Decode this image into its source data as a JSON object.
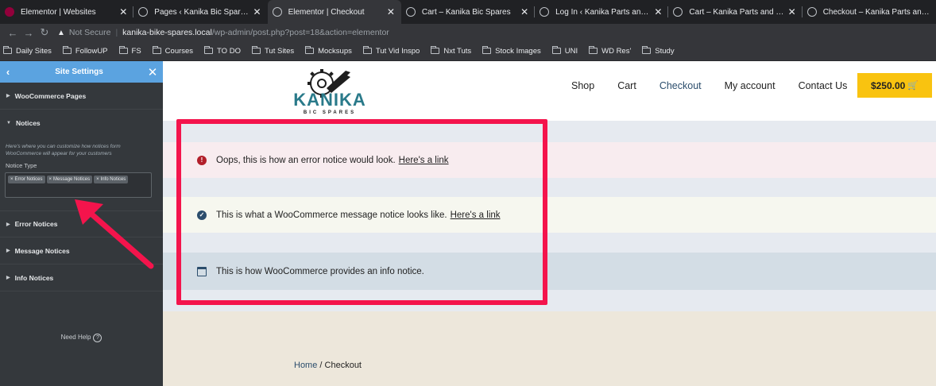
{
  "browser": {
    "tabs": [
      {
        "title": "Elementor | Websites",
        "icon": "elementor-favicon",
        "active": false
      },
      {
        "title": "Pages ‹ Kanika Bic Spares — WordPress",
        "icon": "wordpress-favicon",
        "active": false
      },
      {
        "title": "Elementor | Checkout",
        "icon": "wordpress-favicon",
        "active": true
      },
      {
        "title": "Cart – Kanika Bic Spares",
        "icon": "wordpress-favicon",
        "active": false
      },
      {
        "title": "Log In ‹ Kanika Parts and Spares",
        "icon": "wordpress-favicon",
        "active": false
      },
      {
        "title": "Cart – Kanika Parts and Spares",
        "icon": "wordpress-favicon",
        "active": false
      },
      {
        "title": "Checkout – Kanika Parts and Spares",
        "icon": "wordpress-favicon",
        "active": false
      }
    ],
    "tab_close": "✕",
    "address": {
      "security": "Not Secure",
      "host": "kanika-bike-spares.local",
      "path": "/wp-admin/post.php?post=18&action=elementor"
    },
    "bookmarks": [
      "Daily Sites",
      "FollowUP",
      "FS",
      "Courses",
      "TO DO",
      "Tut Sites",
      "Mocksups",
      "Tut Vid Inspo",
      "Nxt Tuts",
      "Stock Images",
      "UNI",
      "WD Res'",
      "Study"
    ]
  },
  "panel": {
    "title": "Site Settings",
    "sections": {
      "woocommerce_pages": "WooCommerce Pages",
      "notices": "Notices",
      "error_notices": "Error Notices",
      "message_notices": "Message Notices",
      "info_notices": "Info Notices"
    },
    "notices_description": "Here's where you can customize how notices form WooCommerce will appear for your customers",
    "notice_type_label": "Notice Type",
    "notice_type_chips": [
      "Error Notices",
      "Message Notices",
      "Info Notices"
    ],
    "need_help": "Need Help",
    "accent": "#5ba3e0"
  },
  "site": {
    "logo_text": "KANIKA",
    "logo_subtext": "BIC SPARES",
    "nav": [
      "Shop",
      "Cart",
      "Checkout",
      "My account",
      "Contact Us"
    ],
    "active_nav": "Checkout",
    "cart_total": "$250.00",
    "cart_button_color": "#f9c310",
    "notices": {
      "error_text": "Oops, this is how an error notice would look.",
      "error_link": "Here's a link",
      "message_text": "This is what a WooCommerce message notice looks like.",
      "message_link": "Here's a link",
      "info_text": "This is how WooCommerce provides an info notice."
    },
    "breadcrumb": {
      "home": "Home",
      "separator": " / ",
      "current": "Checkout"
    }
  },
  "annotation": {
    "highlight_color": "#f4144c"
  }
}
